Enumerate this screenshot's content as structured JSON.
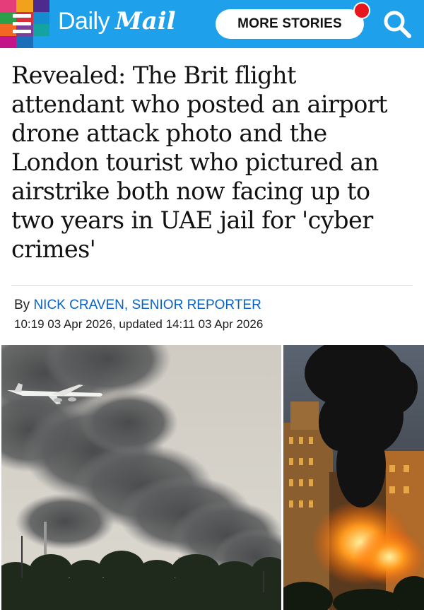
{
  "header": {
    "logo": {
      "word1": "Daily",
      "word2": "Mail"
    },
    "more_stories_label": "MORE STORIES",
    "colors": {
      "bar": "#1ea0ea",
      "notification": "#e8141e"
    },
    "icons": [
      "menu-icon",
      "notification-dot",
      "search-icon"
    ]
  },
  "article": {
    "headline_lines": [
      "Revealed: The Brit flight",
      "attendant who posted an airport",
      "drone attack photo and the",
      "London tourist who pictured an",
      "airstrike both now facing up to",
      "two years in UAE jail for 'cyber",
      "crimes'"
    ],
    "byline_prefix": "By ",
    "author": "NICK CRAVEN, SENIOR REPORTER",
    "dateline": "10:19 03 Apr 2026, updated 14:11 03 Apr 2026",
    "colors": {
      "author_link": "#0a63c4"
    }
  },
  "images": {
    "left": "airliner flying near large smoke plume over trees",
    "right": "building on fire with thick black smoke"
  }
}
